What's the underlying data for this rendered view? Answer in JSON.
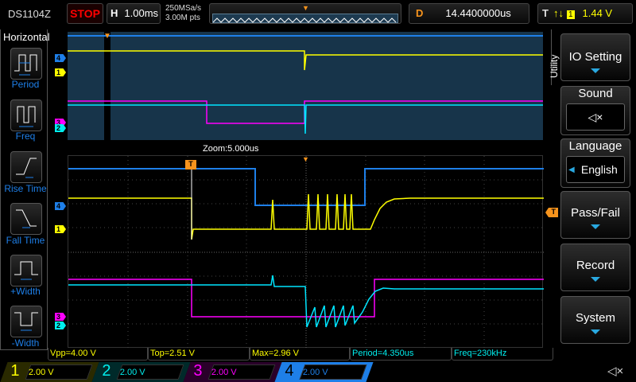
{
  "header": {
    "model": "DS1104Z",
    "run_state": "STOP",
    "timebase_label": "H",
    "timebase": "1.00ms",
    "sample_rate": "250MSa/s",
    "memory_depth": "3.00M pts",
    "delay_label": "D",
    "delay": "14.4400000us",
    "trigger_label": "T",
    "trigger_source": "1",
    "trigger_level": "1.44 V"
  },
  "left_menu": {
    "title": "Horizontal",
    "items": [
      {
        "label": "Period"
      },
      {
        "label": "Freq"
      },
      {
        "label": "Rise Time"
      },
      {
        "label": "Fall Time"
      },
      {
        "label": "+Width"
      },
      {
        "label": "-Width"
      }
    ]
  },
  "display": {
    "zoom_label": "Zoom:5.000us",
    "trigger_marker": "T",
    "channel_markers": [
      "1",
      "2",
      "3",
      "4"
    ]
  },
  "measurements": [
    {
      "text": "Vpp=4.00 V",
      "color": "#ffff00"
    },
    {
      "text": "Top=2.51 V",
      "color": "#ffff00"
    },
    {
      "text": "Max=2.96 V",
      "color": "#ffff00"
    },
    {
      "text": "Period=4.350us",
      "color": "#00e5ff"
    },
    {
      "text": "Freq=230kHz",
      "color": "#00e5ff"
    }
  ],
  "channels": [
    {
      "num": "1",
      "scale": "2.00 V",
      "color": "#ffff00"
    },
    {
      "num": "2",
      "scale": "2.00 V",
      "color": "#00e5ff"
    },
    {
      "num": "3",
      "scale": "2.00 V",
      "color": "#ff00ff"
    },
    {
      "num": "4",
      "scale": "2.00 V",
      "color": "#1e7fe8"
    }
  ],
  "right_menu": {
    "title": "Utility",
    "io_setting": "IO Setting",
    "sound": "Sound",
    "language": "Language",
    "language_value": "English",
    "pass_fail": "Pass/Fail",
    "record": "Record",
    "system": "System"
  }
}
